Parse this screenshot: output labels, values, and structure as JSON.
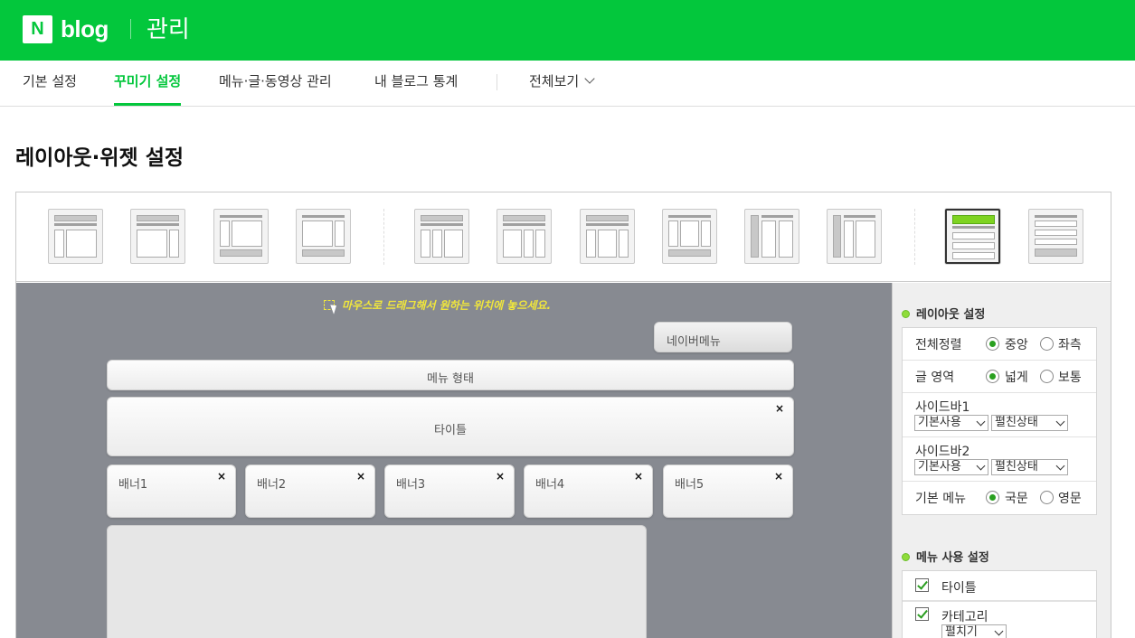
{
  "header": {
    "logo_n": "N",
    "logo_text": "blog",
    "title": "관리"
  },
  "nav": {
    "items": [
      "기본 설정",
      "꾸미기 설정",
      "메뉴·글·동영상 관리",
      "내 블로그 통계"
    ],
    "view_all": "전체보기",
    "active_index": 1
  },
  "page": {
    "title": "레이아웃·위젯 설정"
  },
  "canvas": {
    "hint": "마우스로 드래그해서 원하는 위치에 놓으세요.",
    "naver_menu": "네이버메뉴",
    "menu_form": "메뉴 형태",
    "title_widget": "타이틀",
    "close_symbol": "×",
    "banners": [
      "배너1",
      "배너2",
      "배너3",
      "배너4",
      "배너5"
    ]
  },
  "panel": {
    "layout_section": "레이아웃 설정",
    "align": {
      "label": "전체정렬",
      "options": [
        "중앙",
        "좌측"
      ],
      "selected": "중앙"
    },
    "text_area": {
      "label": "글 영역",
      "options": [
        "넓게",
        "보통"
      ],
      "selected": "넓게"
    },
    "sidebar1": {
      "label": "사이드바1",
      "use": "기본사용",
      "state": "펼친상태"
    },
    "sidebar2": {
      "label": "사이드바2",
      "use": "기본사용",
      "state": "펼친상태"
    },
    "basic_menu": {
      "label": "기본 메뉴",
      "options": [
        "국문",
        "영문"
      ],
      "selected": "국문"
    },
    "menu_section": "메뉴 사용 설정",
    "menu_items": [
      {
        "label": "타이틀",
        "checked": true
      },
      {
        "label": "카테고리",
        "checked": true,
        "select": "펼치기"
      }
    ]
  },
  "colors": {
    "brand": "#03c73c",
    "canvas": "#878a91",
    "hint": "#f1e73b"
  }
}
